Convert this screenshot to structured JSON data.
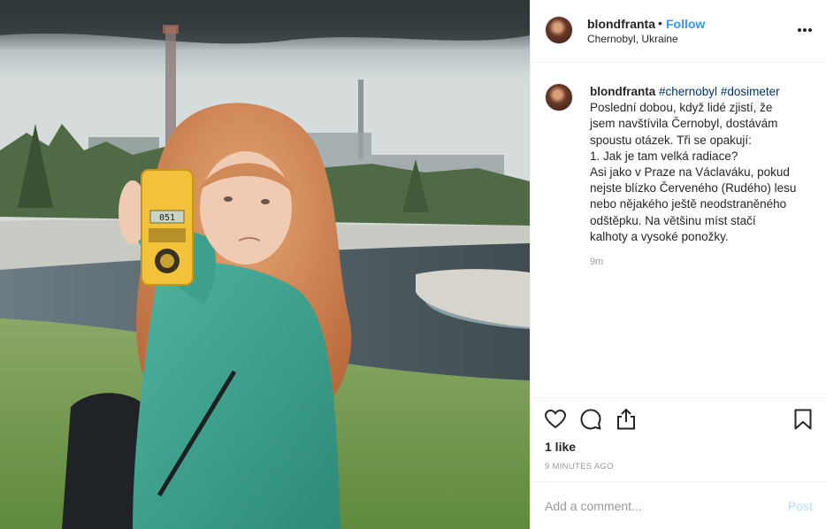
{
  "post": {
    "username": "blondfranta",
    "separator": "•",
    "follow_label": "Follow",
    "location": "Chernobyl, Ukraine",
    "caption": {
      "username": "blondfranta",
      "hashtags": [
        "#chernobyl",
        "#dosimeter"
      ],
      "lines": [
        "Poslední dobou, když lidé zjistí, že",
        "jsem navštívila Černobyl, dostávám",
        "spoustu otázek. Tři se opakují:",
        "1. Jak je tam velká radiace?",
        "Asi jako v Praze na Václaváku, pokud",
        "nejste blízko Červeného (Rudého) lesu",
        "nebo nějakého ještě neodstraněného",
        "odštěpku. Na většinu míst stačí",
        "kalhoty a vysoké ponožky."
      ],
      "time": "9m"
    },
    "likes": "1 like",
    "posted_ago": "9 MINUTES AGO",
    "comment_placeholder": "Add a comment...",
    "post_label": "Post",
    "dosimeter_reading": "051"
  },
  "icons": [
    "heart-icon",
    "comment-icon",
    "share-icon",
    "bookmark-icon",
    "more-options-icon"
  ],
  "colors": {
    "link_blue": "#3897f0",
    "hashtag": "#003569",
    "muted": "#999999",
    "post_disabled": "#b2dffc",
    "text": "#262626"
  }
}
